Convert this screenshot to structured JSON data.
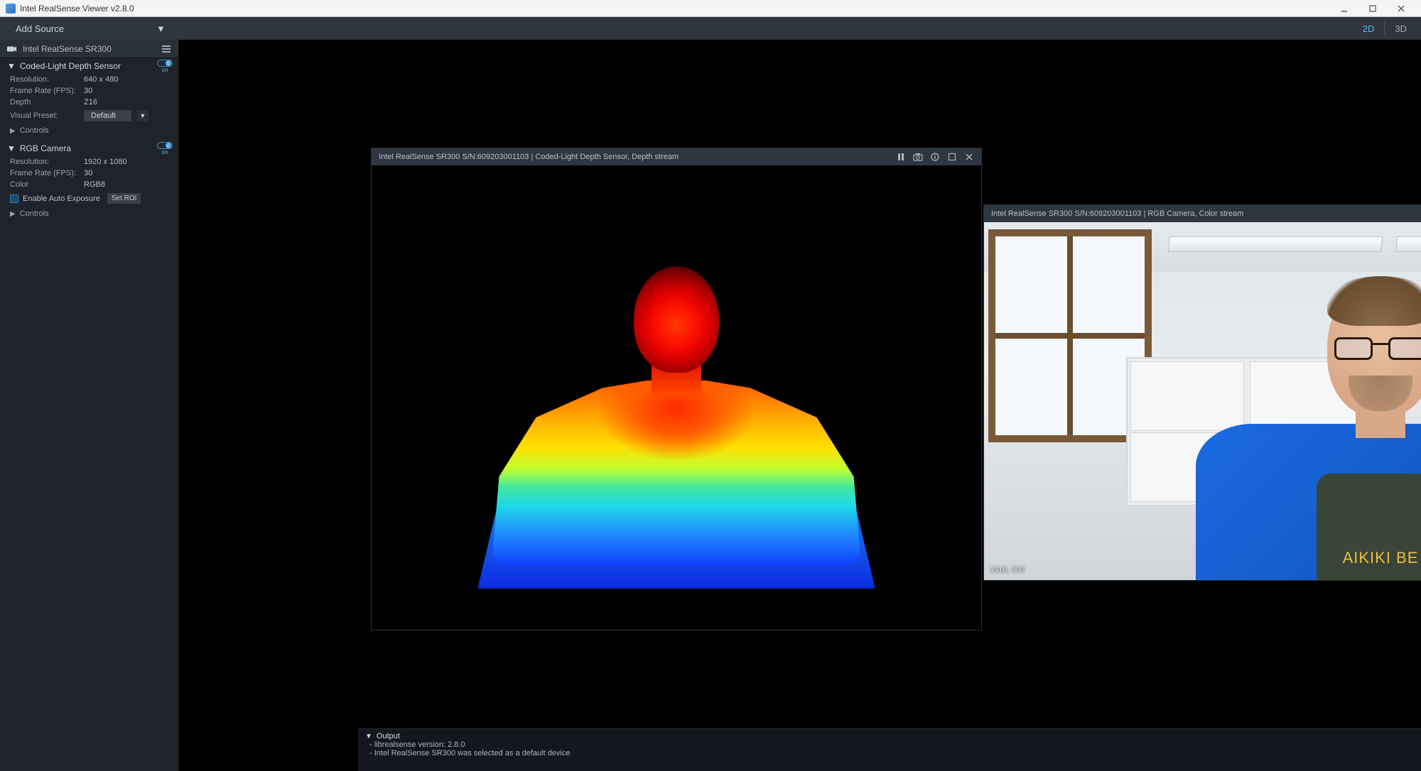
{
  "titlebar": {
    "title": "Intel RealSense Viewer v2.8.0"
  },
  "toolbar": {
    "add_source": "Add Source",
    "view_2d": "2D",
    "view_3d": "3D"
  },
  "sidebar": {
    "device_name": "Intel RealSense SR300",
    "depth_sensor": {
      "title": "Coded-Light Depth Sensor",
      "toggle_state": "on",
      "resolution_label": "Resolution:",
      "resolution_value": "640 x 480",
      "fps_label": "Frame Rate (FPS):",
      "fps_value": "30",
      "format_label": "Depth",
      "format_value": "Z16",
      "preset_label": "Visual Preset:",
      "preset_value": "Default",
      "controls_label": "Controls"
    },
    "rgb_camera": {
      "title": "RGB Camera",
      "toggle_state": "on",
      "resolution_label": "Resolution:",
      "resolution_value": "1920 x 1080",
      "fps_label": "Frame Rate (FPS):",
      "fps_value": "30",
      "format_label": "Color",
      "format_value": "RGB8",
      "auto_exposure_label": "Enable Auto Exposure",
      "set_roi_label": "Set ROI",
      "controls_label": "Controls"
    }
  },
  "panels": {
    "depth": {
      "title": "Intel RealSense SR300 S/N:609203001103 | Coded-Light Depth Sensor, Depth stream"
    },
    "color": {
      "title": "Intel RealSense SR300 S/N:609203001103 | RGB Camera, Color stream",
      "overlay_coords": "1916, 906",
      "tee_text": "AIKIKI BE"
    }
  },
  "output": {
    "header": "Output",
    "lines": [
      "- librealsense version: 2.8.0",
      "- Intel RealSense SR300 was selected as a default device"
    ]
  }
}
